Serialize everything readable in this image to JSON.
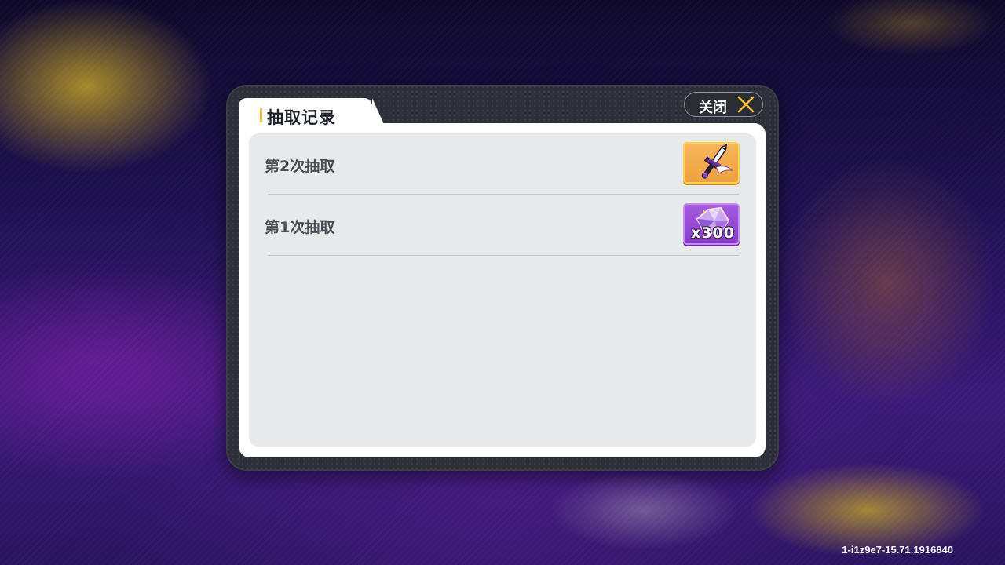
{
  "dialog": {
    "title": "抽取记录",
    "close_label": "关闭",
    "accent_color": "#f2c12e"
  },
  "history": [
    {
      "label": "第2次抽取",
      "reward": {
        "icon": "sword-weapon-icon",
        "rarity": "gold",
        "count": ""
      }
    },
    {
      "label": "第1次抽取",
      "reward": {
        "icon": "purple-crystal-icon",
        "rarity": "purple",
        "count": "x300"
      }
    }
  ],
  "footer": {
    "build_id": "1-i1z9e7-15.71.1916840"
  }
}
